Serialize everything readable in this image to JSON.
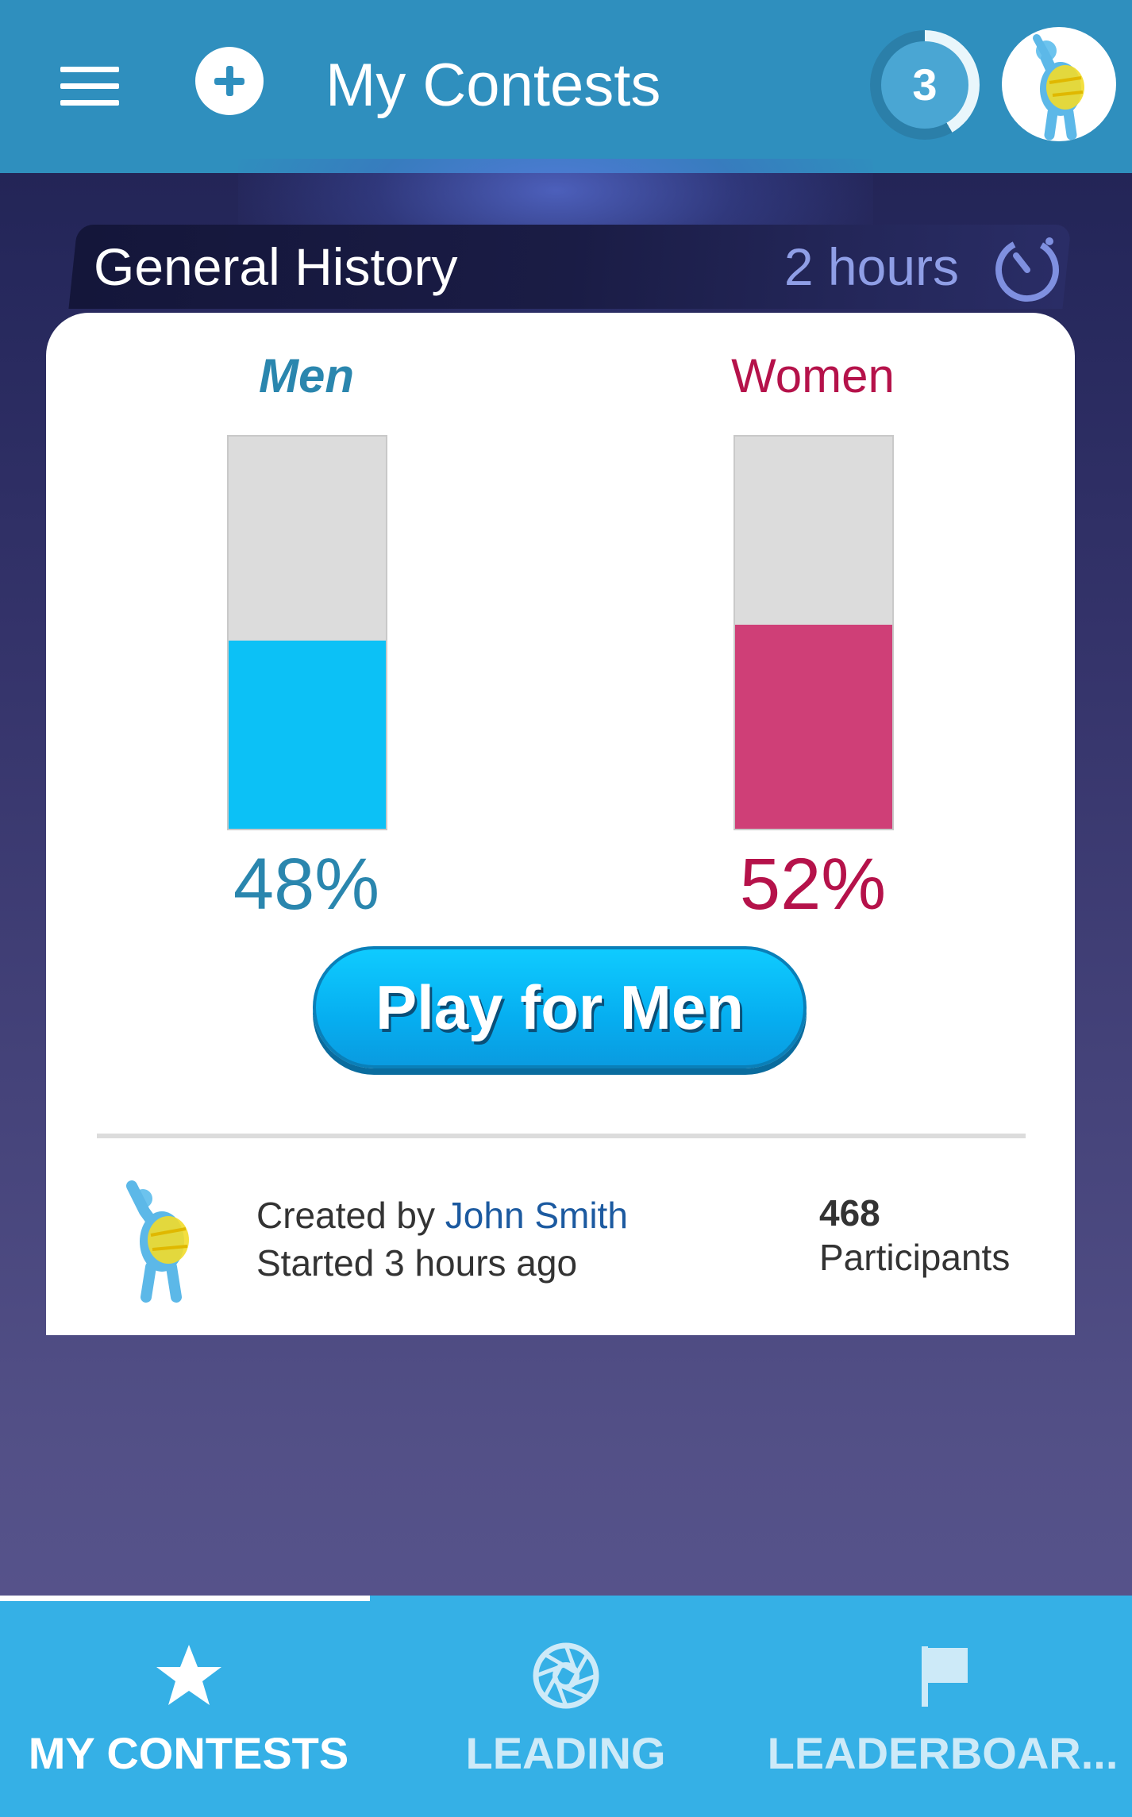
{
  "header": {
    "title": "My Contests",
    "notification_count": "3",
    "icons": [
      "menu-icon",
      "add-icon",
      "avatar"
    ]
  },
  "contest": {
    "topic": "General History",
    "time_left": "2 hours",
    "men": {
      "label": "Men",
      "percent_text": "48%",
      "percent": 48
    },
    "women": {
      "label": "Women",
      "percent_text": "52%",
      "percent": 52
    },
    "play_button": "Play for Men",
    "created_prefix": "Created by ",
    "creator_name": "John Smith",
    "started": "Started 3 hours ago",
    "participants_count": "468",
    "participants_label": "Participants"
  },
  "nav": {
    "tabs": [
      {
        "label": "MY CONTESTS",
        "icon": "star-icon",
        "active": true
      },
      {
        "label": "LEADING",
        "icon": "aperture-icon",
        "active": false
      },
      {
        "label": "LEADERBOAR...",
        "icon": "flag-icon",
        "active": false
      }
    ]
  },
  "colors": {
    "appbar": "#2f8fbe",
    "men": "#0cc1f6",
    "women": "#cf3f77",
    "men_text": "#2a86ae",
    "women_text": "#b5124a",
    "nav": "#35b0e6"
  }
}
